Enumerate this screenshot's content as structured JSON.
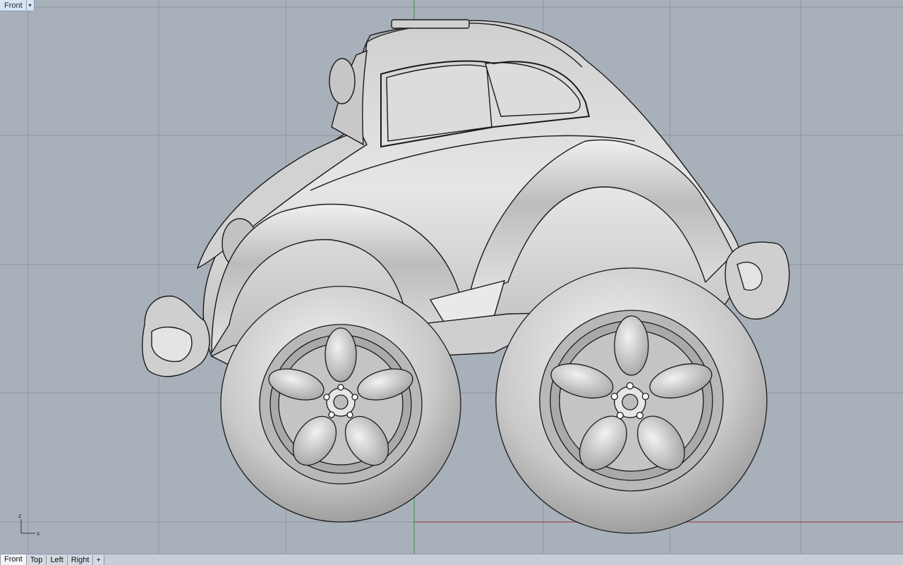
{
  "viewport": {
    "title": "Front",
    "menu_glyph": "▾",
    "axis": {
      "z": "z",
      "x": "x"
    }
  },
  "tabs": [
    {
      "label": "Front",
      "active": true
    },
    {
      "label": "Top",
      "active": false
    },
    {
      "label": "Left",
      "active": false
    },
    {
      "label": "Right",
      "active": false
    }
  ],
  "add_tab_glyph": "+",
  "colors": {
    "background": "#a8b0ba",
    "grid_line": "#9aa2ad",
    "major_grid_line": "#8d96a1",
    "x_axis": "#a33535",
    "y_axis": "#2e9a3c",
    "model_shade": "#d9dadb"
  },
  "model": {
    "name": "cartoon-beetle-car-model"
  }
}
